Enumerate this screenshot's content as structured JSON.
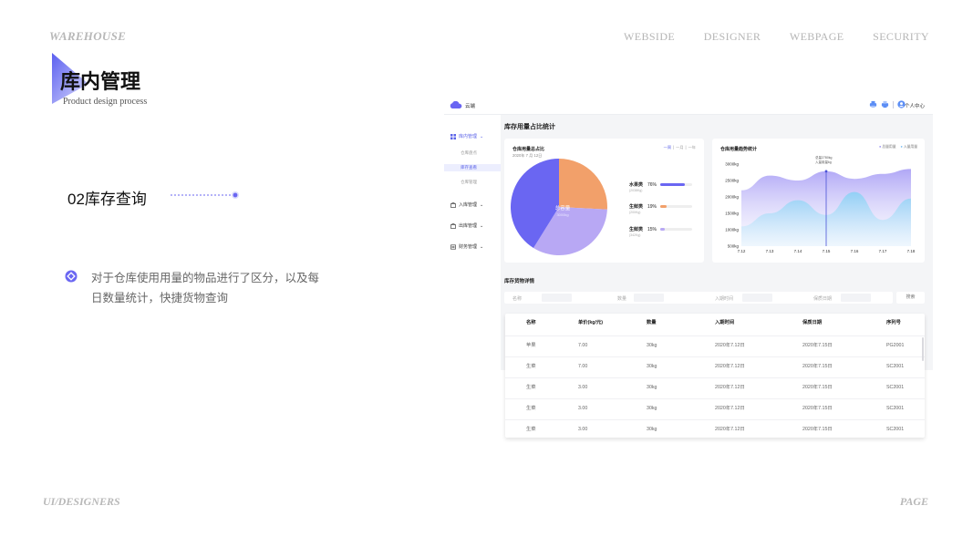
{
  "slide": {
    "brand": "WAREHOUSE",
    "nav": [
      "WEBSIDE",
      "DESIGNER",
      "WEBPAGE",
      "SECURITY"
    ],
    "title": "库内管理",
    "subtitle": "Product design process",
    "heading": "02库存查询",
    "description": "对于仓库使用用量的物品进行了区分，以及每日数量统计，快捷货物查询",
    "footer_left": "UI/DESIGNERS",
    "footer_right": "PAGE"
  },
  "app": {
    "logo": "云端",
    "user": "个人中心",
    "header_icons": [
      "printer-icon",
      "print-icon",
      "user-icon"
    ],
    "sidebar": {
      "menus": [
        {
          "label": "库内管理",
          "icon": "grid-icon",
          "active": true
        },
        {
          "label": "入库管理",
          "icon": "inbox-in-icon",
          "active": false
        },
        {
          "label": "出库管理",
          "icon": "inbox-out-icon",
          "active": false
        },
        {
          "label": "财务管理",
          "icon": "finance-icon",
          "active": false
        }
      ],
      "submenus": [
        {
          "label": "仓库盘点",
          "active": false
        },
        {
          "label": "库存查看",
          "active": true
        },
        {
          "label": "仓库管理",
          "active": false
        }
      ]
    },
    "main_title": "库存用量占比统计",
    "pie_card": {
      "title": "仓库用量总占比",
      "date": "2020年 7 月 12日",
      "range": [
        "一周",
        "一月",
        "一年"
      ],
      "center_label": "总容量",
      "center_value": "3000kg",
      "items": [
        {
          "name": "水果类",
          "pct": 76,
          "pct_text": "76%",
          "sub": "(2038Kg)",
          "color": "#6a66f2"
        },
        {
          "name": "生鲜类",
          "pct": 19,
          "pct_text": "19%",
          "sub": "(200Kg)",
          "color": "#f2a06a"
        },
        {
          "name": "生鲜类",
          "pct": 15,
          "pct_text": "15%",
          "sub": "(342Kg)",
          "color": "#b8a8f4"
        }
      ]
    },
    "trend_card": {
      "title": "仓库用量趋势统计",
      "legend": [
        "总量用量",
        "入量用量"
      ],
      "tooltip": [
        "总量2780kg",
        "入量用量kg"
      ]
    },
    "section2_title": "库存货物详情",
    "filter": {
      "labels": [
        "名称",
        "数量",
        "入期时间",
        "保质日期"
      ],
      "search_button": "搜索"
    }
  },
  "chart_data": {
    "type": "area",
    "x": [
      "7.12",
      "7.13",
      "7.14",
      "7.15",
      "7.16",
      "7.17",
      "7.18"
    ],
    "y_ticks": [
      "3000kg",
      "2500kg",
      "2000kg",
      "1500kg",
      "1000kg",
      "500kg"
    ],
    "ylim": [
      500,
      3000
    ],
    "series": [
      {
        "name": "总量用量",
        "values": [
          2200,
          2650,
          2500,
          2780,
          2550,
          2700,
          2850
        ]
      },
      {
        "name": "入量用量",
        "values": [
          1100,
          1500,
          1900,
          1450,
          2150,
          1300,
          1950
        ]
      }
    ],
    "highlight_x": "7.15"
  },
  "table": {
    "columns": [
      "名称",
      "单价(kg/元)",
      "数量",
      "入期时间",
      "保质日期",
      "序列号"
    ],
    "rows": [
      [
        "苹果",
        "7.00",
        "30kg",
        "2020年7.12日",
        "2020年7.15日",
        "PG2001"
      ],
      [
        "生菜",
        "7.00",
        "30kg",
        "2020年7.12日",
        "2020年7.15日",
        "SC2001"
      ],
      [
        "生菜",
        "3.00",
        "30kg",
        "2020年7.12日",
        "2020年7.15日",
        "SC2001"
      ],
      [
        "生菜",
        "3.00",
        "30kg",
        "2020年7.12日",
        "2020年7.15日",
        "SC2001"
      ],
      [
        "生菜",
        "3.00",
        "30kg",
        "2020年7.12日",
        "2020年7.15日",
        "SC2001"
      ]
    ]
  }
}
